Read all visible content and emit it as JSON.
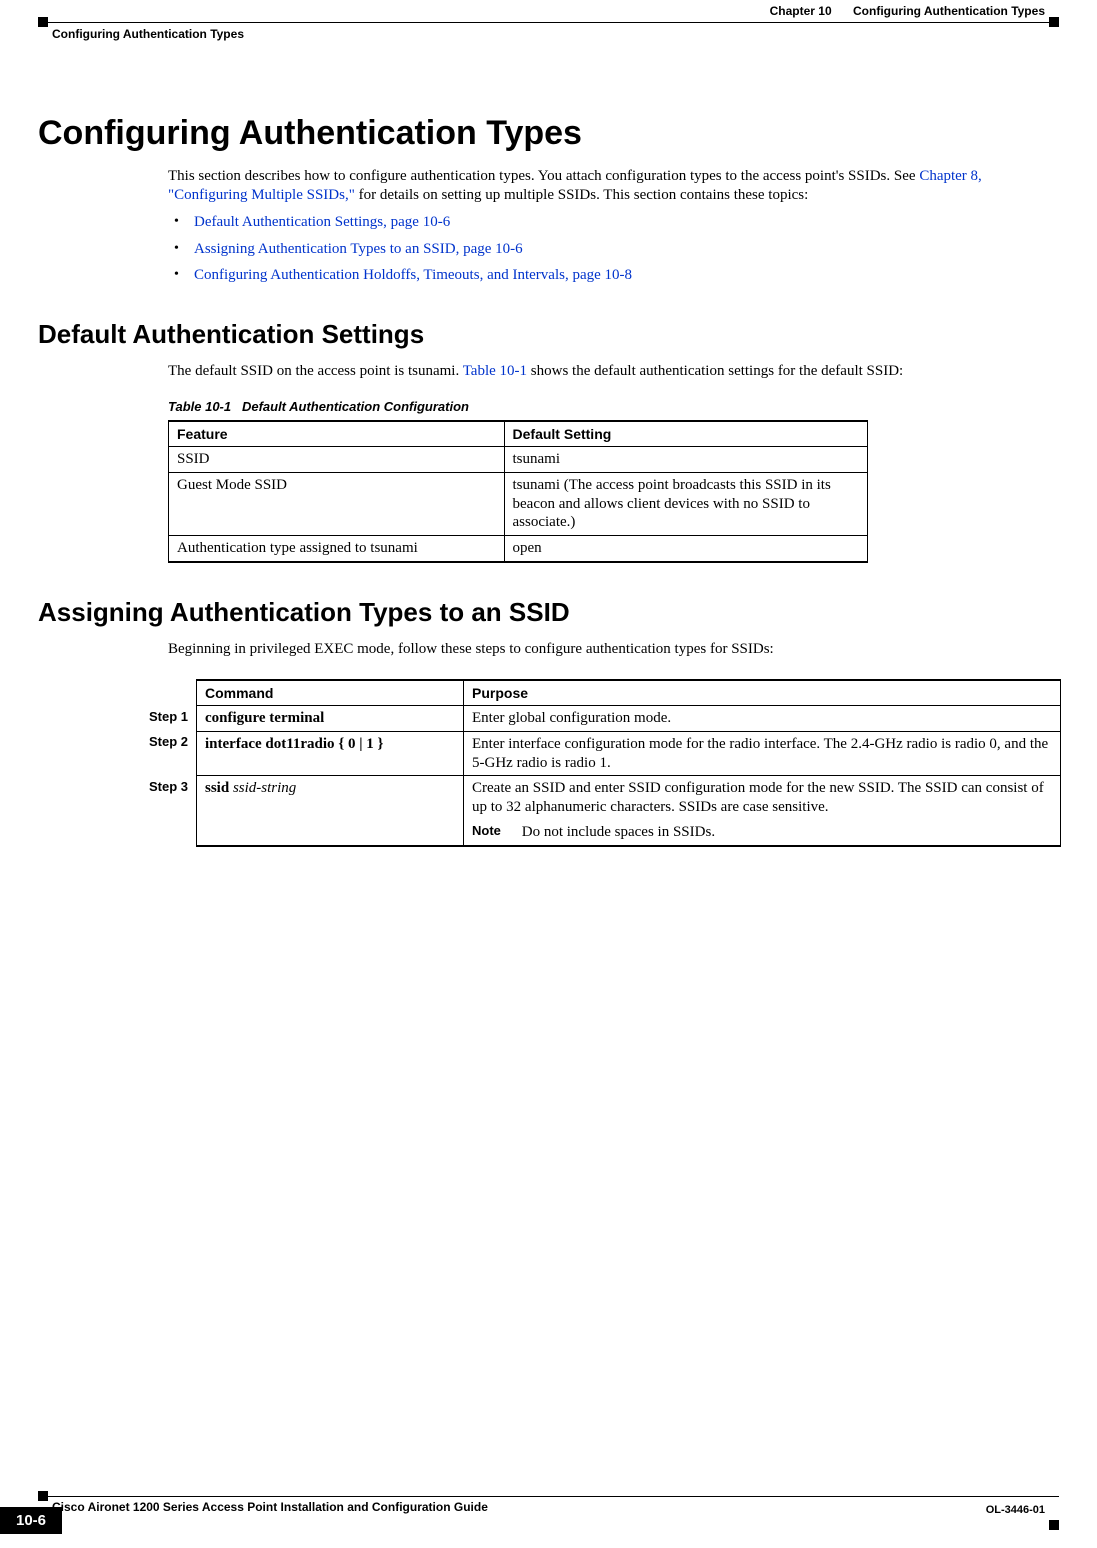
{
  "header": {
    "chapter_label": "Chapter 10",
    "chapter_title": "Configuring Authentication Types",
    "breadcrumb": "Configuring Authentication Types"
  },
  "section": {
    "title": "Configuring Authentication Types",
    "intro_before_link": "This section describes how to configure authentication types. You attach configuration types to the access point's SSIDs. See ",
    "intro_link": "Chapter 8, \"Configuring Multiple SSIDs,\"",
    "intro_after_link": " for details on setting up multiple SSIDs. This section contains these topics:",
    "bullets": [
      "Default Authentication Settings, page 10-6",
      "Assigning Authentication Types to an SSID, page 10-6",
      "Configuring Authentication Holdoffs, Timeouts, and Intervals, page 10-8"
    ]
  },
  "default_auth": {
    "heading": "Default Authentication Settings",
    "para_before": "The default SSID on the access point is tsunami. ",
    "para_link": "Table 10-1",
    "para_after": " shows the default authentication settings for the default SSID:",
    "table_caption_num": "Table 10-1",
    "table_caption_title": "Default Authentication Configuration",
    "th_feature": "Feature",
    "th_default": "Default Setting",
    "rows": [
      {
        "feature": "SSID",
        "value": "tsunami"
      },
      {
        "feature": "Guest Mode SSID",
        "value": "tsunami (The access point broadcasts this SSID in its beacon and allows client devices with no SSID to associate.)"
      },
      {
        "feature": "Authentication type assigned to tsunami",
        "value": "open"
      }
    ]
  },
  "assign": {
    "heading": "Assigning Authentication Types to an SSID",
    "intro": "Beginning in privileged EXEC mode, follow these steps to configure authentication types for SSIDs:",
    "th_command": "Command",
    "th_purpose": "Purpose",
    "steps": [
      {
        "step": "Step 1",
        "command_bold": "configure terminal",
        "command_tail": "",
        "purpose": "Enter global configuration mode."
      },
      {
        "step": "Step 2",
        "command_bold": "interface dot11radio",
        "command_tail": " { 0 | 1 }",
        "purpose": "Enter interface configuration mode for the radio interface. The 2.4-GHz radio is radio 0, and the 5-GHz radio is radio 1."
      },
      {
        "step": "Step 3",
        "command_bold": "ssid",
        "command_italic": " ssid-string",
        "purpose": "Create an SSID and enter SSID configuration mode for the new SSID. The SSID can consist of up to 32 alphanumeric characters. SSIDs are case sensitive.",
        "note_label": "Note",
        "note_text": "Do not include spaces in SSIDs."
      }
    ]
  },
  "footer": {
    "book_title": "Cisco Aironet 1200 Series Access Point Installation and Configuration Guide",
    "doc_id": "OL-3446-01",
    "page_num": "10-6"
  }
}
